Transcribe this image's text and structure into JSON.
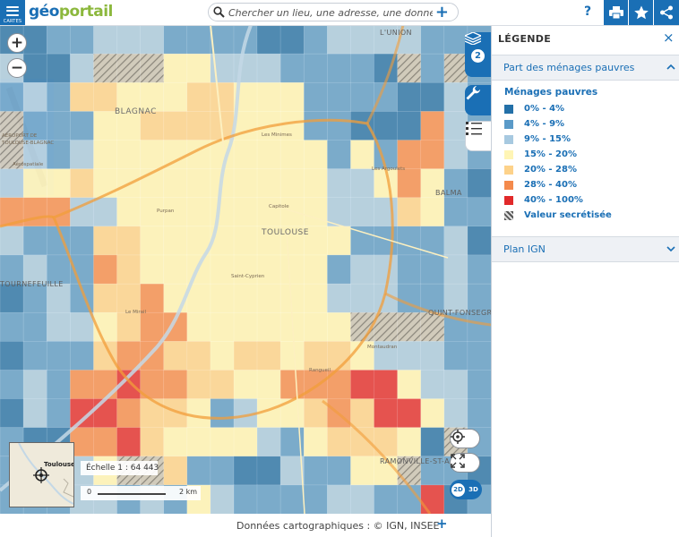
{
  "app": {
    "logo_a": "géo",
    "logo_b": "portail",
    "menu_caption": "CARTES"
  },
  "search": {
    "placeholder": "Chercher un lieu, une adresse, une donnée"
  },
  "toolbar": {
    "help": "?",
    "print_icon": "printer-icon",
    "favorite_icon": "star-icon",
    "share_icon": "share-icon"
  },
  "map": {
    "labels": {
      "city": "TOULOUSE",
      "blagnac": "BLAGNAC",
      "union": "L'UNION",
      "balma": "BALMA",
      "tournefeuille": "TOURNEFEUILLE",
      "quint": "QUINT-FONSEGRIVES",
      "ramonville": "RAMONVILLE-ST-AGNE",
      "aeroport1": "AÉROPORT DE",
      "aeroport2": "TOULOUSE-BLAGNAC",
      "aerospatiale": "Aérospatiale",
      "capitole": "Capitole",
      "minimes": "Les Minimes",
      "mirail": "Le Mirail",
      "rangueil": "Rangueil",
      "purpan": "Purpan",
      "montaudran": "Montaudran",
      "argoulets": "Les Argoulets",
      "saint_cyprien": "Saint-Cyprien"
    },
    "overview_label": "Toulouse",
    "scale_label": "Échelle 1 : 64 443",
    "scale_zero": "0",
    "scale_km": "2 km",
    "zoom_in": "+",
    "zoom_out": "−",
    "layers_count": "2",
    "view_2d": "2D",
    "view_3d": "3D"
  },
  "attribution": {
    "text": "Données cartographiques : ©     IGN,  INSEE",
    "plus": "+"
  },
  "legend": {
    "title": "LÉGENDE",
    "close": "×",
    "layer1": "Part des ménages pauvres",
    "subtitle": "Ménages pauvres",
    "items": [
      {
        "label": "0% - 4%",
        "color": "#2370a8"
      },
      {
        "label": "4% - 9%",
        "color": "#5a9ac8"
      },
      {
        "label": "9% - 15%",
        "color": "#a7c9e0"
      },
      {
        "label": "15% - 20%",
        "color": "#fff5b5"
      },
      {
        "label": "20% - 28%",
        "color": "#fdd28a"
      },
      {
        "label": "28% - 40%",
        "color": "#f48a4c"
      },
      {
        "label": "40% - 100%",
        "color": "#e1292a"
      },
      {
        "label": "Valeur secrétisée",
        "color": "hatch"
      }
    ],
    "layer2": "Plan IGN"
  }
}
